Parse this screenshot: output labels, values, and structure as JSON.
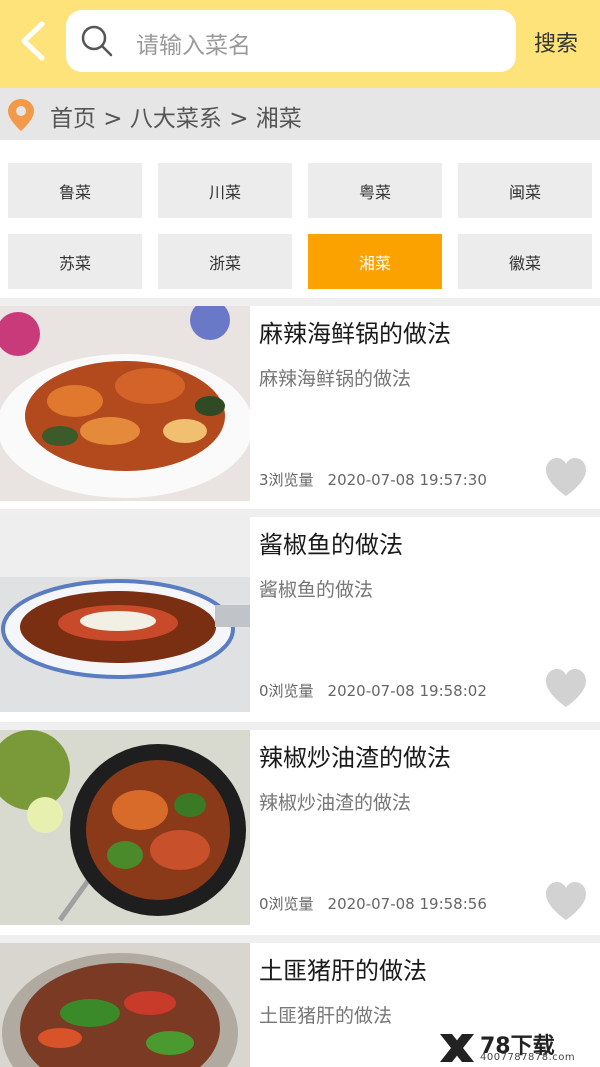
{
  "header": {
    "search_placeholder": "请输入菜名",
    "search_label": "搜索",
    "colors": {
      "bar": "#fde37a",
      "accent": "#fba200"
    }
  },
  "breadcrumb": {
    "text": "首页 > 八大菜系 > 湘菜",
    "icon": "location-pin-icon"
  },
  "categories": [
    {
      "label": "鲁菜",
      "active": false
    },
    {
      "label": "川菜",
      "active": false
    },
    {
      "label": "粤菜",
      "active": false
    },
    {
      "label": "闽菜",
      "active": false
    },
    {
      "label": "苏菜",
      "active": false
    },
    {
      "label": "浙菜",
      "active": false
    },
    {
      "label": "湘菜",
      "active": true
    },
    {
      "label": "徽菜",
      "active": false
    }
  ],
  "recipes": [
    {
      "title": "麻辣海鲜锅的做法",
      "subtitle": "麻辣海鲜锅的做法",
      "views": "3浏览量",
      "time": "2020-07-08 19:57:30"
    },
    {
      "title": "酱椒鱼的做法",
      "subtitle": "酱椒鱼的做法",
      "views": "0浏览量",
      "time": "2020-07-08 19:58:02"
    },
    {
      "title": "辣椒炒油渣的做法",
      "subtitle": "辣椒炒油渣的做法",
      "views": "0浏览量",
      "time": "2020-07-08 19:58:56"
    },
    {
      "title": "土匪猪肝的做法",
      "subtitle": "土匪猪肝的做法",
      "views": "",
      "time": ""
    }
  ],
  "watermark": {
    "brand": "78下载",
    "url": "4007787878.com"
  }
}
